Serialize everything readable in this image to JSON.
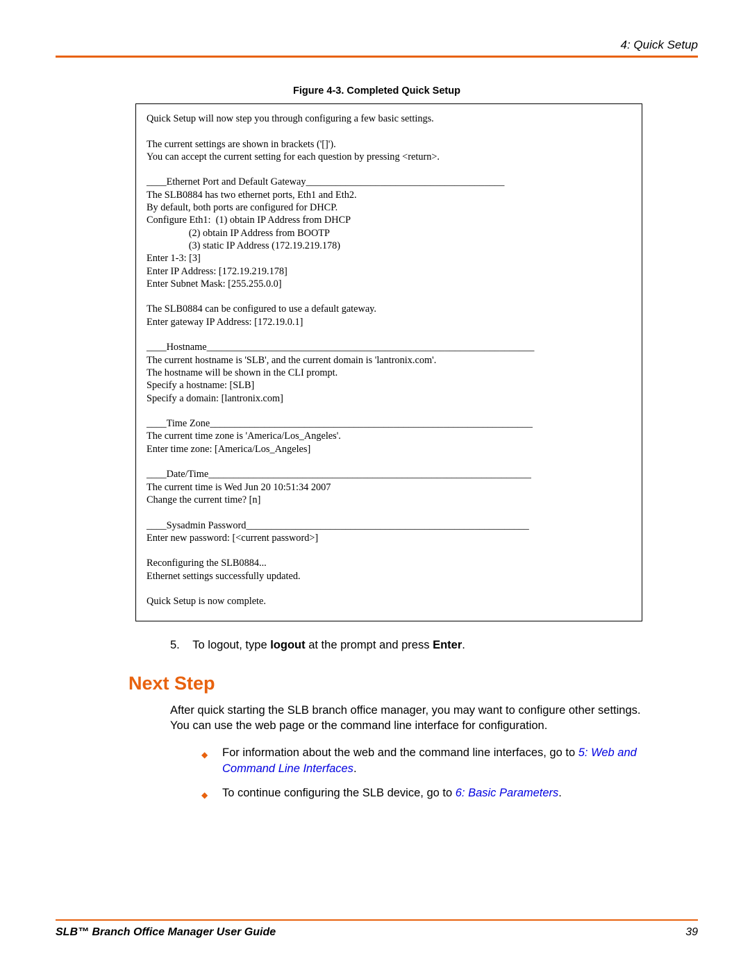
{
  "header": {
    "chapter": "4: Quick Setup"
  },
  "figure": {
    "caption": "Figure 4-3. Completed Quick Setup",
    "terminal": "Quick Setup will now step you through configuring a few basic settings.\n\nThe current settings are shown in brackets ('[]').\nYou can accept the current setting for each question by pressing <return>.\n\n____Ethernet Port and Default Gateway________________________________________\nThe SLB0884 has two ethernet ports, Eth1 and Eth2.\nBy default, both ports are configured for DHCP.\nConfigure Eth1:  (1) obtain IP Address from DHCP\n                 (2) obtain IP Address from BOOTP\n                 (3) static IP Address (172.19.219.178)\nEnter 1-3: [3]\nEnter IP Address: [172.19.219.178]\nEnter Subnet Mask: [255.255.0.0]\n\nThe SLB0884 can be configured to use a default gateway.\nEnter gateway IP Address: [172.19.0.1]\n\n____Hostname__________________________________________________________________\nThe current hostname is 'SLB', and the current domain is 'lantronix.com'.\nThe hostname will be shown in the CLI prompt.\nSpecify a hostname: [SLB]\nSpecify a domain: [lantronix.com]\n\n____Time Zone_________________________________________________________________\nThe current time zone is 'America/Los_Angeles'.\nEnter time zone: [America/Los_Angeles]\n\n____Date/Time_________________________________________________________________\nThe current time is Wed Jun 20 10:51:34 2007\nChange the current time? [n]\n\n____Sysadmin Password_________________________________________________________\nEnter new password: [<current password>]\n\nReconfiguring the SLB0884...\nEthernet settings successfully updated.\n\nQuick Setup is now complete."
  },
  "step": {
    "number": "5.",
    "text_before": "To logout, type ",
    "bold1": "logout",
    "text_mid": " at the prompt and press ",
    "bold2": "Enter",
    "text_after": "."
  },
  "heading": "Next Step",
  "para": "After quick starting the SLB branch office manager, you may want to configure other settings. You can use the web page or the command line interface for configuration.",
  "bullets": [
    {
      "text_before": "For information about the web and the command line interfaces, go to ",
      "link": "5: Web and Command Line Interfaces",
      "text_after": "."
    },
    {
      "text_before": "To continue configuring the SLB device, go to ",
      "link": "6: Basic Parameters",
      "text_after": "."
    }
  ],
  "footer": {
    "left": "SLB™ Branch Office Manager User Guide",
    "right": "39"
  }
}
